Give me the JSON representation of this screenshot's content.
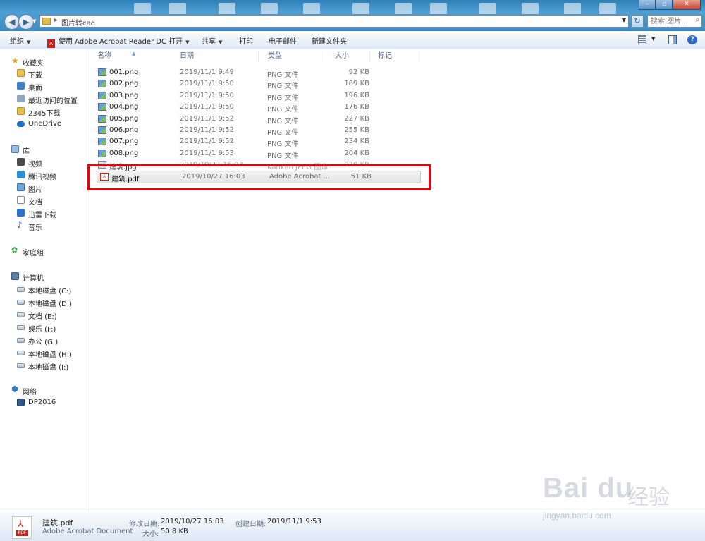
{
  "window": {
    "address_path": "图片转cad",
    "search_placeholder": "搜索 图片...",
    "close_glyph": "✕",
    "maximize_glyph": "▫",
    "minimize_glyph": "–"
  },
  "toolbar": {
    "organize": "组织",
    "open_with": "使用 Adobe Acrobat Reader DC 打开",
    "share": "共享",
    "print": "打印",
    "email": "电子邮件",
    "new_folder": "新建文件夹",
    "help": "?"
  },
  "sidebar": {
    "favorites": "收藏夹",
    "favorites_items": [
      "下载",
      "桌面",
      "最近访问的位置",
      "2345下载",
      "OneDrive"
    ],
    "libraries": "库",
    "library_items": [
      "视频",
      "腾讯视频",
      "图片",
      "文档",
      "迅雷下载",
      "音乐"
    ],
    "homegroup": "家庭组",
    "computer": "计算机",
    "computer_items": [
      "本地磁盘 (C:)",
      "本地磁盘 (D:)",
      "文档 (E:)",
      "娱乐 (F:)",
      "办公 (G:)",
      "本地磁盘 (H:)",
      "本地磁盘 (I:)"
    ],
    "network": "网络",
    "network_items": [
      "DP2016"
    ]
  },
  "columns": {
    "name": "名称",
    "date": "日期",
    "type": "类型",
    "size": "大小",
    "tags": "标记"
  },
  "files": [
    {
      "name": "001.png",
      "date": "2019/11/1 9:49",
      "type": "PNG 文件",
      "size": "92 KB"
    },
    {
      "name": "002.png",
      "date": "2019/11/1 9:50",
      "type": "PNG 文件",
      "size": "189 KB"
    },
    {
      "name": "003.png",
      "date": "2019/11/1 9:50",
      "type": "PNG 文件",
      "size": "196 KB"
    },
    {
      "name": "004.png",
      "date": "2019/11/1 9:50",
      "type": "PNG 文件",
      "size": "176 KB"
    },
    {
      "name": "005.png",
      "date": "2019/11/1 9:52",
      "type": "PNG 文件",
      "size": "227 KB"
    },
    {
      "name": "006.png",
      "date": "2019/11/1 9:52",
      "type": "PNG 文件",
      "size": "255 KB"
    },
    {
      "name": "007.png",
      "date": "2019/11/1 9:52",
      "type": "PNG 文件",
      "size": "234 KB"
    },
    {
      "name": "008.png",
      "date": "2019/11/1 9:53",
      "type": "PNG 文件",
      "size": "204 KB"
    },
    {
      "name": "建筑.jpg",
      "date": "2019/10/27 16:03",
      "type": "Kankan JPEG 图像",
      "size": "978 KB"
    },
    {
      "name": "建筑.pdf",
      "date": "2019/10/27 16:03",
      "type": "Adobe Acrobat ...",
      "size": "51 KB"
    }
  ],
  "details": {
    "name": "建筑.pdf",
    "type": "Adobe Acrobat Document",
    "modified_label": "修改日期:",
    "modified_value": "2019/10/27 16:03",
    "created_label": "创建日期:",
    "created_value": "2019/11/1 9:53",
    "size_label": "大小:",
    "size_value": "50.8 KB",
    "icon_tag": "PDF"
  },
  "watermark": {
    "logo": "Bai  du",
    "cn": "经验",
    "url": "jingyan.baidu.com"
  },
  "colors": {
    "titlebar": "#3c8cc6",
    "highlight": "#e8000f",
    "pdf_red": "#c9221b"
  }
}
